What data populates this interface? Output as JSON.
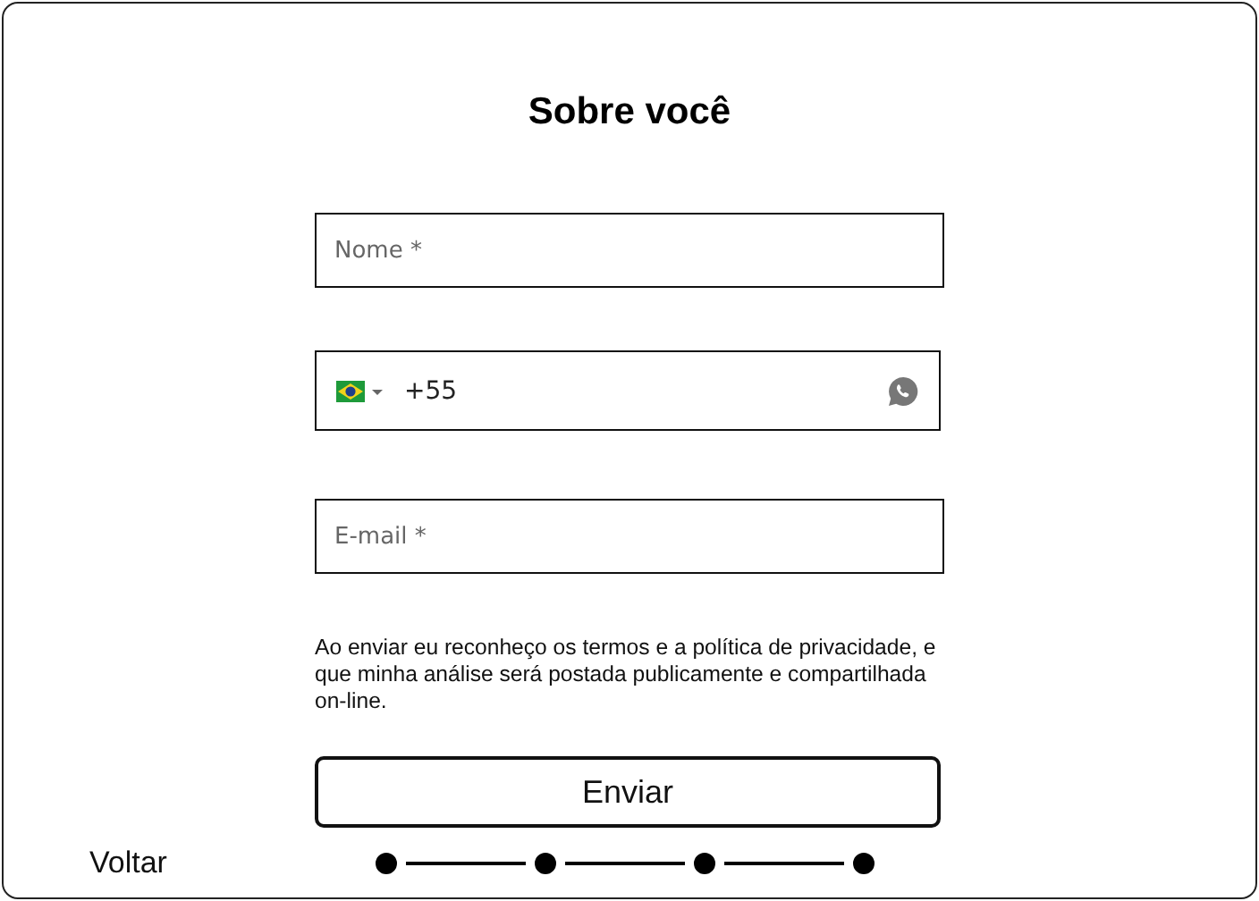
{
  "title": "Sobre você",
  "name_field": {
    "placeholder": "Nome *"
  },
  "phone_field": {
    "value": "+55"
  },
  "email_field": {
    "placeholder": "E-mail *"
  },
  "consent_text": "Ao enviar eu reconheço os termos e a política de privacidade, e que minha análise será postada publicamente e compartilhada on-line.",
  "submit_button": "Enviar",
  "back_link": "Voltar",
  "steps": [
    {
      "done": true
    },
    {
      "done": true
    },
    {
      "done": true
    },
    {
      "done": true
    }
  ]
}
